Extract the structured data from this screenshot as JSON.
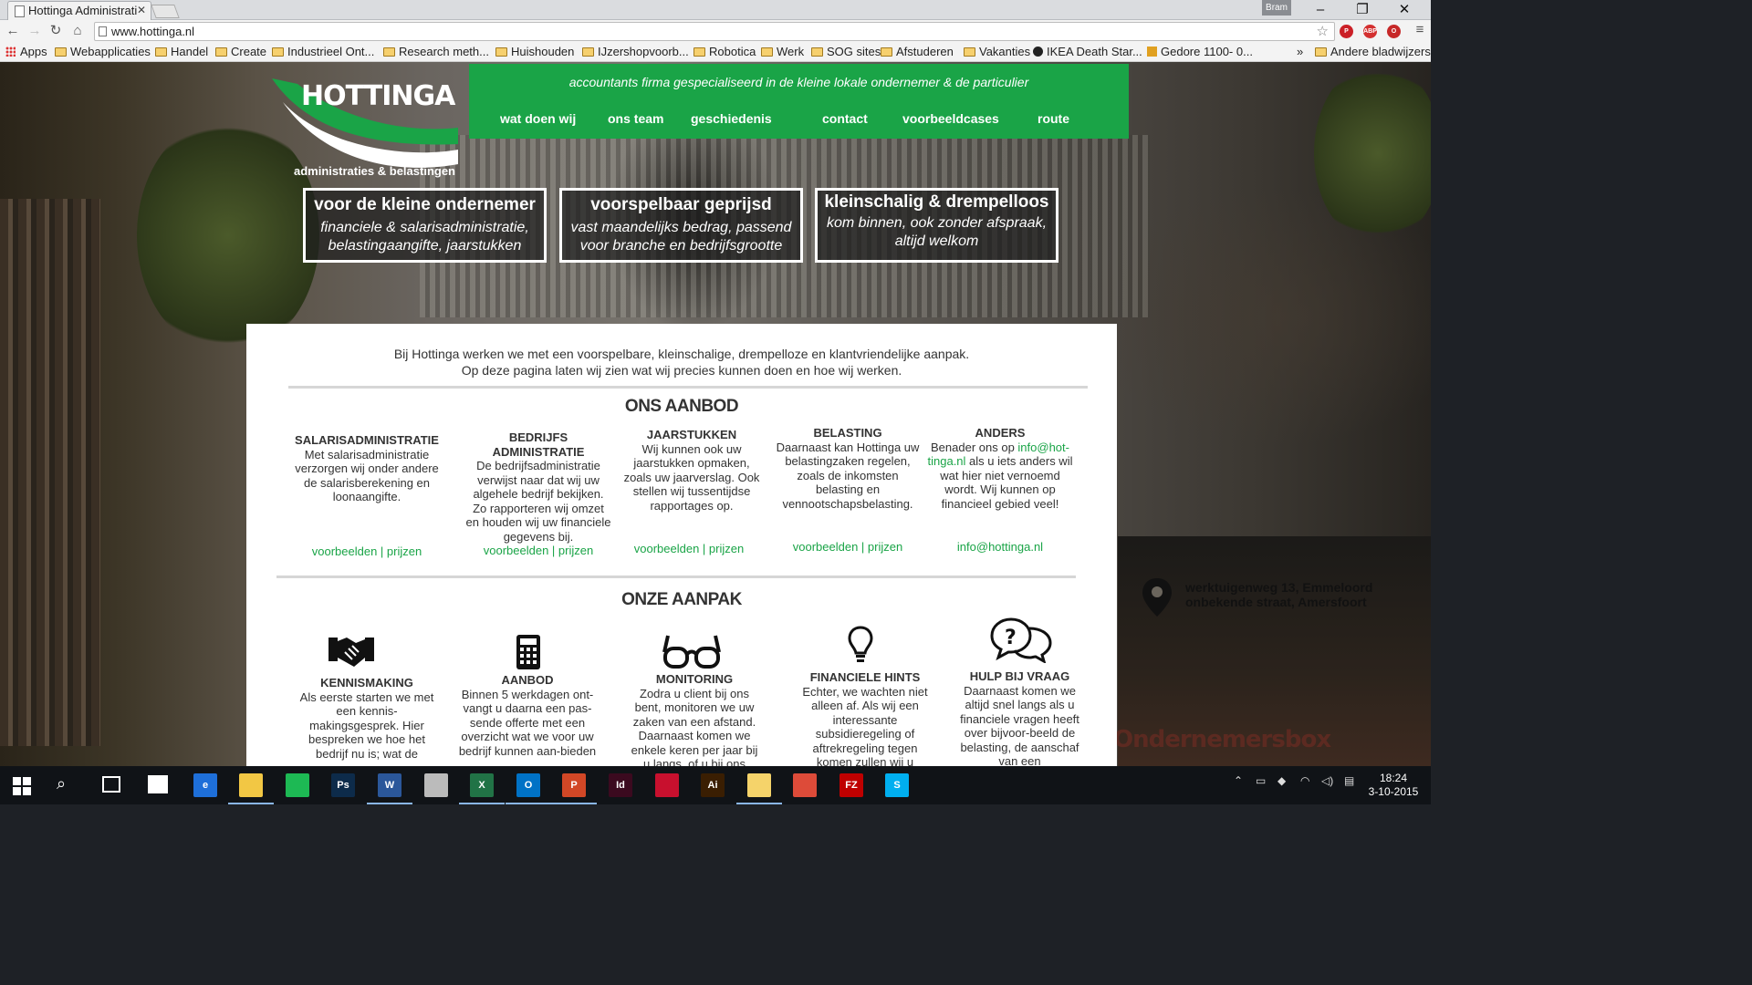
{
  "browser": {
    "tab_title": "Hottinga Administrati",
    "profile": "Bram",
    "url": "www.hottinga.nl",
    "bookmarks": [
      {
        "label": "Apps",
        "type": "apps"
      },
      {
        "label": "Webapplicaties",
        "type": "folder"
      },
      {
        "label": "Handel",
        "type": "folder"
      },
      {
        "label": "Create",
        "type": "folder"
      },
      {
        "label": "Industrieel Ont...",
        "type": "folder"
      },
      {
        "label": "Research meth...",
        "type": "folder"
      },
      {
        "label": "Huishouden",
        "type": "folder"
      },
      {
        "label": "IJzershopvoorb...",
        "type": "folder"
      },
      {
        "label": "Robotica",
        "type": "folder"
      },
      {
        "label": "Werk",
        "type": "folder"
      },
      {
        "label": "SOG sites",
        "type": "folder"
      },
      {
        "label": "Afstuderen",
        "type": "folder"
      },
      {
        "label": "Vakanties",
        "type": "folder"
      },
      {
        "label": "IKEA Death Star...",
        "type": "site"
      },
      {
        "label": "Gedore 1100- 0...",
        "type": "site"
      }
    ],
    "more_bookmarks": "»",
    "other_bookmarks": "Andere bladwijzers",
    "extensions": [
      {
        "name": "pinterest-icon",
        "color": "#cb2027",
        "text": "P"
      },
      {
        "name": "adblock-icon",
        "color": "#d32f2f",
        "text": "ABP"
      },
      {
        "name": "opera-icon",
        "color": "#c62828",
        "text": "O"
      }
    ]
  },
  "site": {
    "logo": {
      "title": "HOTTINGA",
      "subtitle": "administraties & belastingen"
    },
    "tagline": "accountants firma gespecialiseerd in de kleine lokale ondernemer & de particulier",
    "nav": [
      "wat doen wij",
      "ons team",
      "geschiedenis",
      "contact",
      "voorbeeldcases",
      "route"
    ],
    "promos": [
      {
        "heading": "voor de kleine ondernemer",
        "text": "financiele & salarisadministratie, belastingaangifte, jaarstukken"
      },
      {
        "heading": "voorspelbaar geprijsd",
        "text": "vast maandelijks bedrag, passend voor branche en bedrijfsgrootte"
      },
      {
        "heading": "kleinschalig & drempelloos",
        "text": "kom binnen, ook zonder afspraak, altijd welkom"
      }
    ],
    "intro_line1": "Bij Hottinga werken we met een voorspelbare, kleinschalige, drempelloze en klantvriendelijke aanpak.",
    "intro_line2": "Op deze pagina laten wij zien wat wij precies kunnen doen en hoe wij werken.",
    "aanbod_title": "ONS AANBOD",
    "aanbod": [
      {
        "title": "SALARISADMINISTRATIE",
        "text": "Met salarisadministratie verzorgen wij onder andere de salarisberekening en loonaangifte.",
        "link": "voorbeelden | prijzen"
      },
      {
        "title": "BEDRIJFS ADMINISTRATIE",
        "text": "De bedrijfsadministratie verwijst naar dat wij uw algehele bedrijf bekijken. Zo rapporteren wij omzet en houden wij uw financiele gegevens bij.",
        "link": "voorbeelden | prijzen"
      },
      {
        "title": "JAARSTUKKEN",
        "text": "Wij kunnen ook uw jaarstukken opmaken, zoals uw jaarverslag. Ook stellen wij tussentijdse rapportages op.",
        "link": "voorbeelden | prijzen"
      },
      {
        "title": "BELASTING",
        "text": "Daarnaast kan Hottinga uw belastingzaken regelen, zoals de inkomsten belasting en vennootschapsbelasting.",
        "link": "voorbeelden | prijzen"
      },
      {
        "title": "ANDERS",
        "text_before": "Benader ons op ",
        "email_inline": "info@hot-tinga.nl",
        "text_after": " als u iets anders wil wat hier niet vernoemd wordt. Wij kunnen op financieel gebied veel!",
        "link": "info@hottinga.nl"
      }
    ],
    "aanpak_title": "ONZE AANPAK",
    "aanpak": [
      {
        "title": "KENNISMAKING",
        "icon": "handshake-icon",
        "text": "Als eerste starten we met een kennis-makingsgesprek. Hier bespreken we hoe het bedrijf nu is; wat de"
      },
      {
        "title": "AANBOD",
        "icon": "calculator-icon",
        "text": "Binnen 5 werkdagen ont-vangt u daarna een pas-sende offerte met een overzicht wat we voor uw bedrijf kunnen aan-bieden"
      },
      {
        "title": "MONITORING",
        "icon": "glasses-icon",
        "text": "Zodra u client bij ons bent, monitoren we uw zaken van een afstand. Daarnaast komen we enkele keren per jaar bij u langs, of u bij ons"
      },
      {
        "title": "FINANCIELE HINTS",
        "icon": "lightbulb-icon",
        "text": "Echter, we wachten niet alleen af. Als wij een interessante subsidieregeling of aftrekregeling tegen komen zullen wij u"
      },
      {
        "title": "HULP BIJ VRAAG",
        "icon": "question-bubbles-icon",
        "text": "Daarnaast komen we altijd snel langs als u financiele vragen heeft over bijvoor-beeld de belasting, de aanschaf van een"
      }
    ],
    "address_line1": "werktuigenweg 13, Emmeloord",
    "address_line2": "onbekende straat, Amersfoort",
    "background_sign": "Ondernemersbox",
    "accent_color": "#1aa447"
  },
  "taskbar": {
    "apps": [
      {
        "name": "edge-icon",
        "label": "e",
        "color": "#1e6fd9"
      },
      {
        "name": "explorer-icon",
        "label": "",
        "color": "#f2c744"
      },
      {
        "name": "spotify-icon",
        "label": "",
        "color": "#1db954"
      },
      {
        "name": "photoshop-icon",
        "label": "Ps",
        "color": "#0d2b4a"
      },
      {
        "name": "word-icon",
        "label": "W",
        "color": "#2b579a"
      },
      {
        "name": "paint-icon",
        "label": "",
        "color": "#bbbbbb"
      },
      {
        "name": "excel-icon",
        "label": "X",
        "color": "#217346"
      },
      {
        "name": "outlook-icon",
        "label": "O",
        "color": "#0072c6"
      },
      {
        "name": "powerpoint-icon",
        "label": "P",
        "color": "#d24726"
      },
      {
        "name": "indesign-icon",
        "label": "Id",
        "color": "#3b0a1f"
      },
      {
        "name": "acrobat-icon",
        "label": "",
        "color": "#c8102e"
      },
      {
        "name": "illustrator-icon",
        "label": "Ai",
        "color": "#3a1e02"
      },
      {
        "name": "folder-icon",
        "label": "",
        "color": "#f5d36a"
      },
      {
        "name": "chrome-icon",
        "label": "",
        "color": "#dd4b39"
      },
      {
        "name": "filezilla-icon",
        "label": "FZ",
        "color": "#bf0000"
      },
      {
        "name": "skype-icon",
        "label": "S",
        "color": "#00aff0"
      }
    ],
    "time": "18:24",
    "date": "3-10-2015"
  }
}
